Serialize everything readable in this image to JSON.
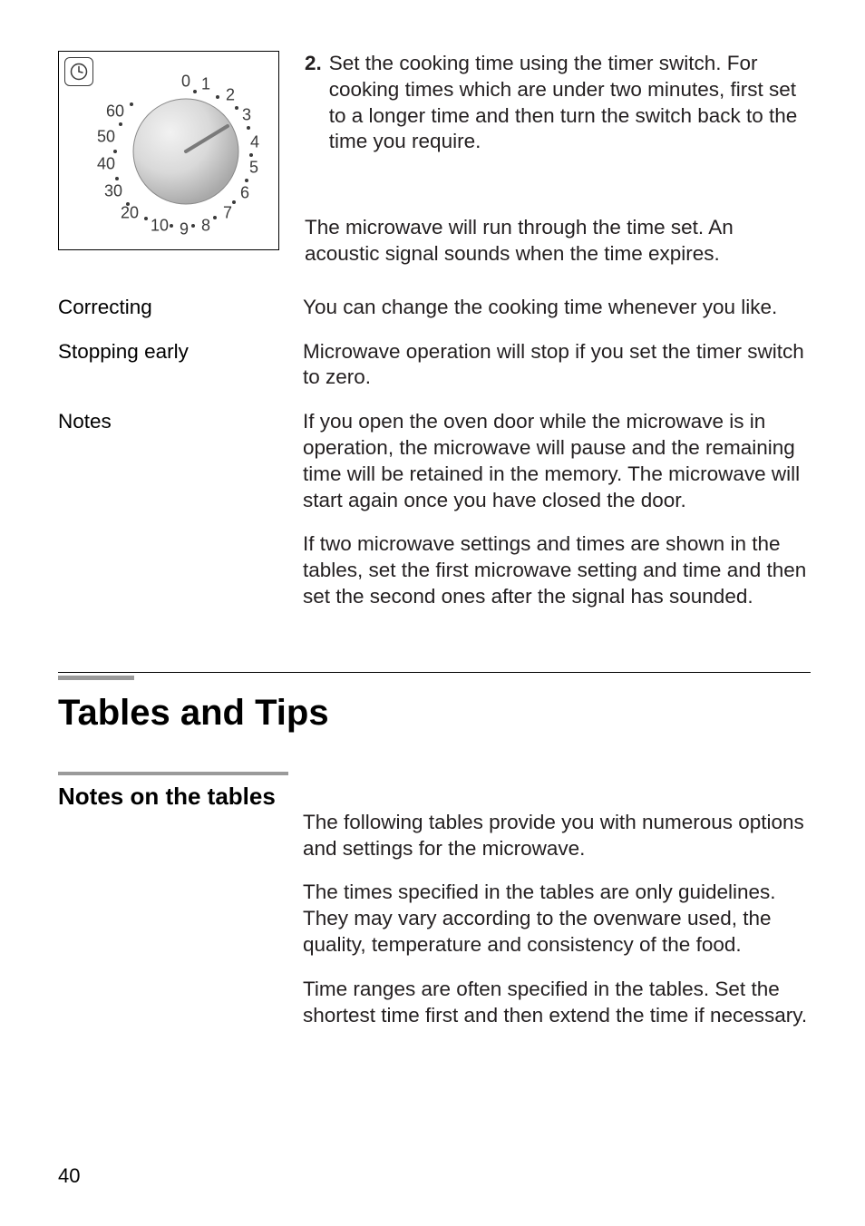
{
  "figure": {
    "dial_major": [
      "0",
      "1",
      "2",
      "3",
      "4",
      "5",
      "6",
      "7",
      "8",
      "9",
      "10",
      "20",
      "30",
      "40",
      "50",
      "60"
    ]
  },
  "step2": {
    "num": "2.",
    "text": "Set the cooking time using the timer switch. For cooking times which are under two minutes, first set to a longer time and then turn the switch back to the time you require."
  },
  "run_para": "The microwave will run through the time set. An acoustic signal sounds when the time expires.",
  "rows": {
    "correcting": {
      "label": "Correcting",
      "text": "You can change the cooking time whenever you like."
    },
    "stopping": {
      "label": "Stopping early",
      "text": "Microwave operation will stop if you set the timer switch to zero."
    },
    "notes": {
      "label": "Notes",
      "p1": "If you open the oven door while the microwave is in operation, the microwave will pause and the remaining time will be retained in the memory. The microwave will start again once you have closed the door.",
      "p2": "If two microwave settings and times are shown in the tables, set the first microwave setting and time and then set the second ones after the signal has sounded."
    }
  },
  "section": {
    "title": "Tables and Tips",
    "subhead": "Notes on the tables",
    "p1": "The following tables provide you with numerous options and settings for the microwave.",
    "p2": "The times specified in the tables are only guidelines. They may vary according to the ovenware used, the quality, temperature and consistency of the food.",
    "p3": "Time ranges are often specified in the tables. Set the shortest time first and then extend the time if necessary."
  },
  "page_number": "40"
}
